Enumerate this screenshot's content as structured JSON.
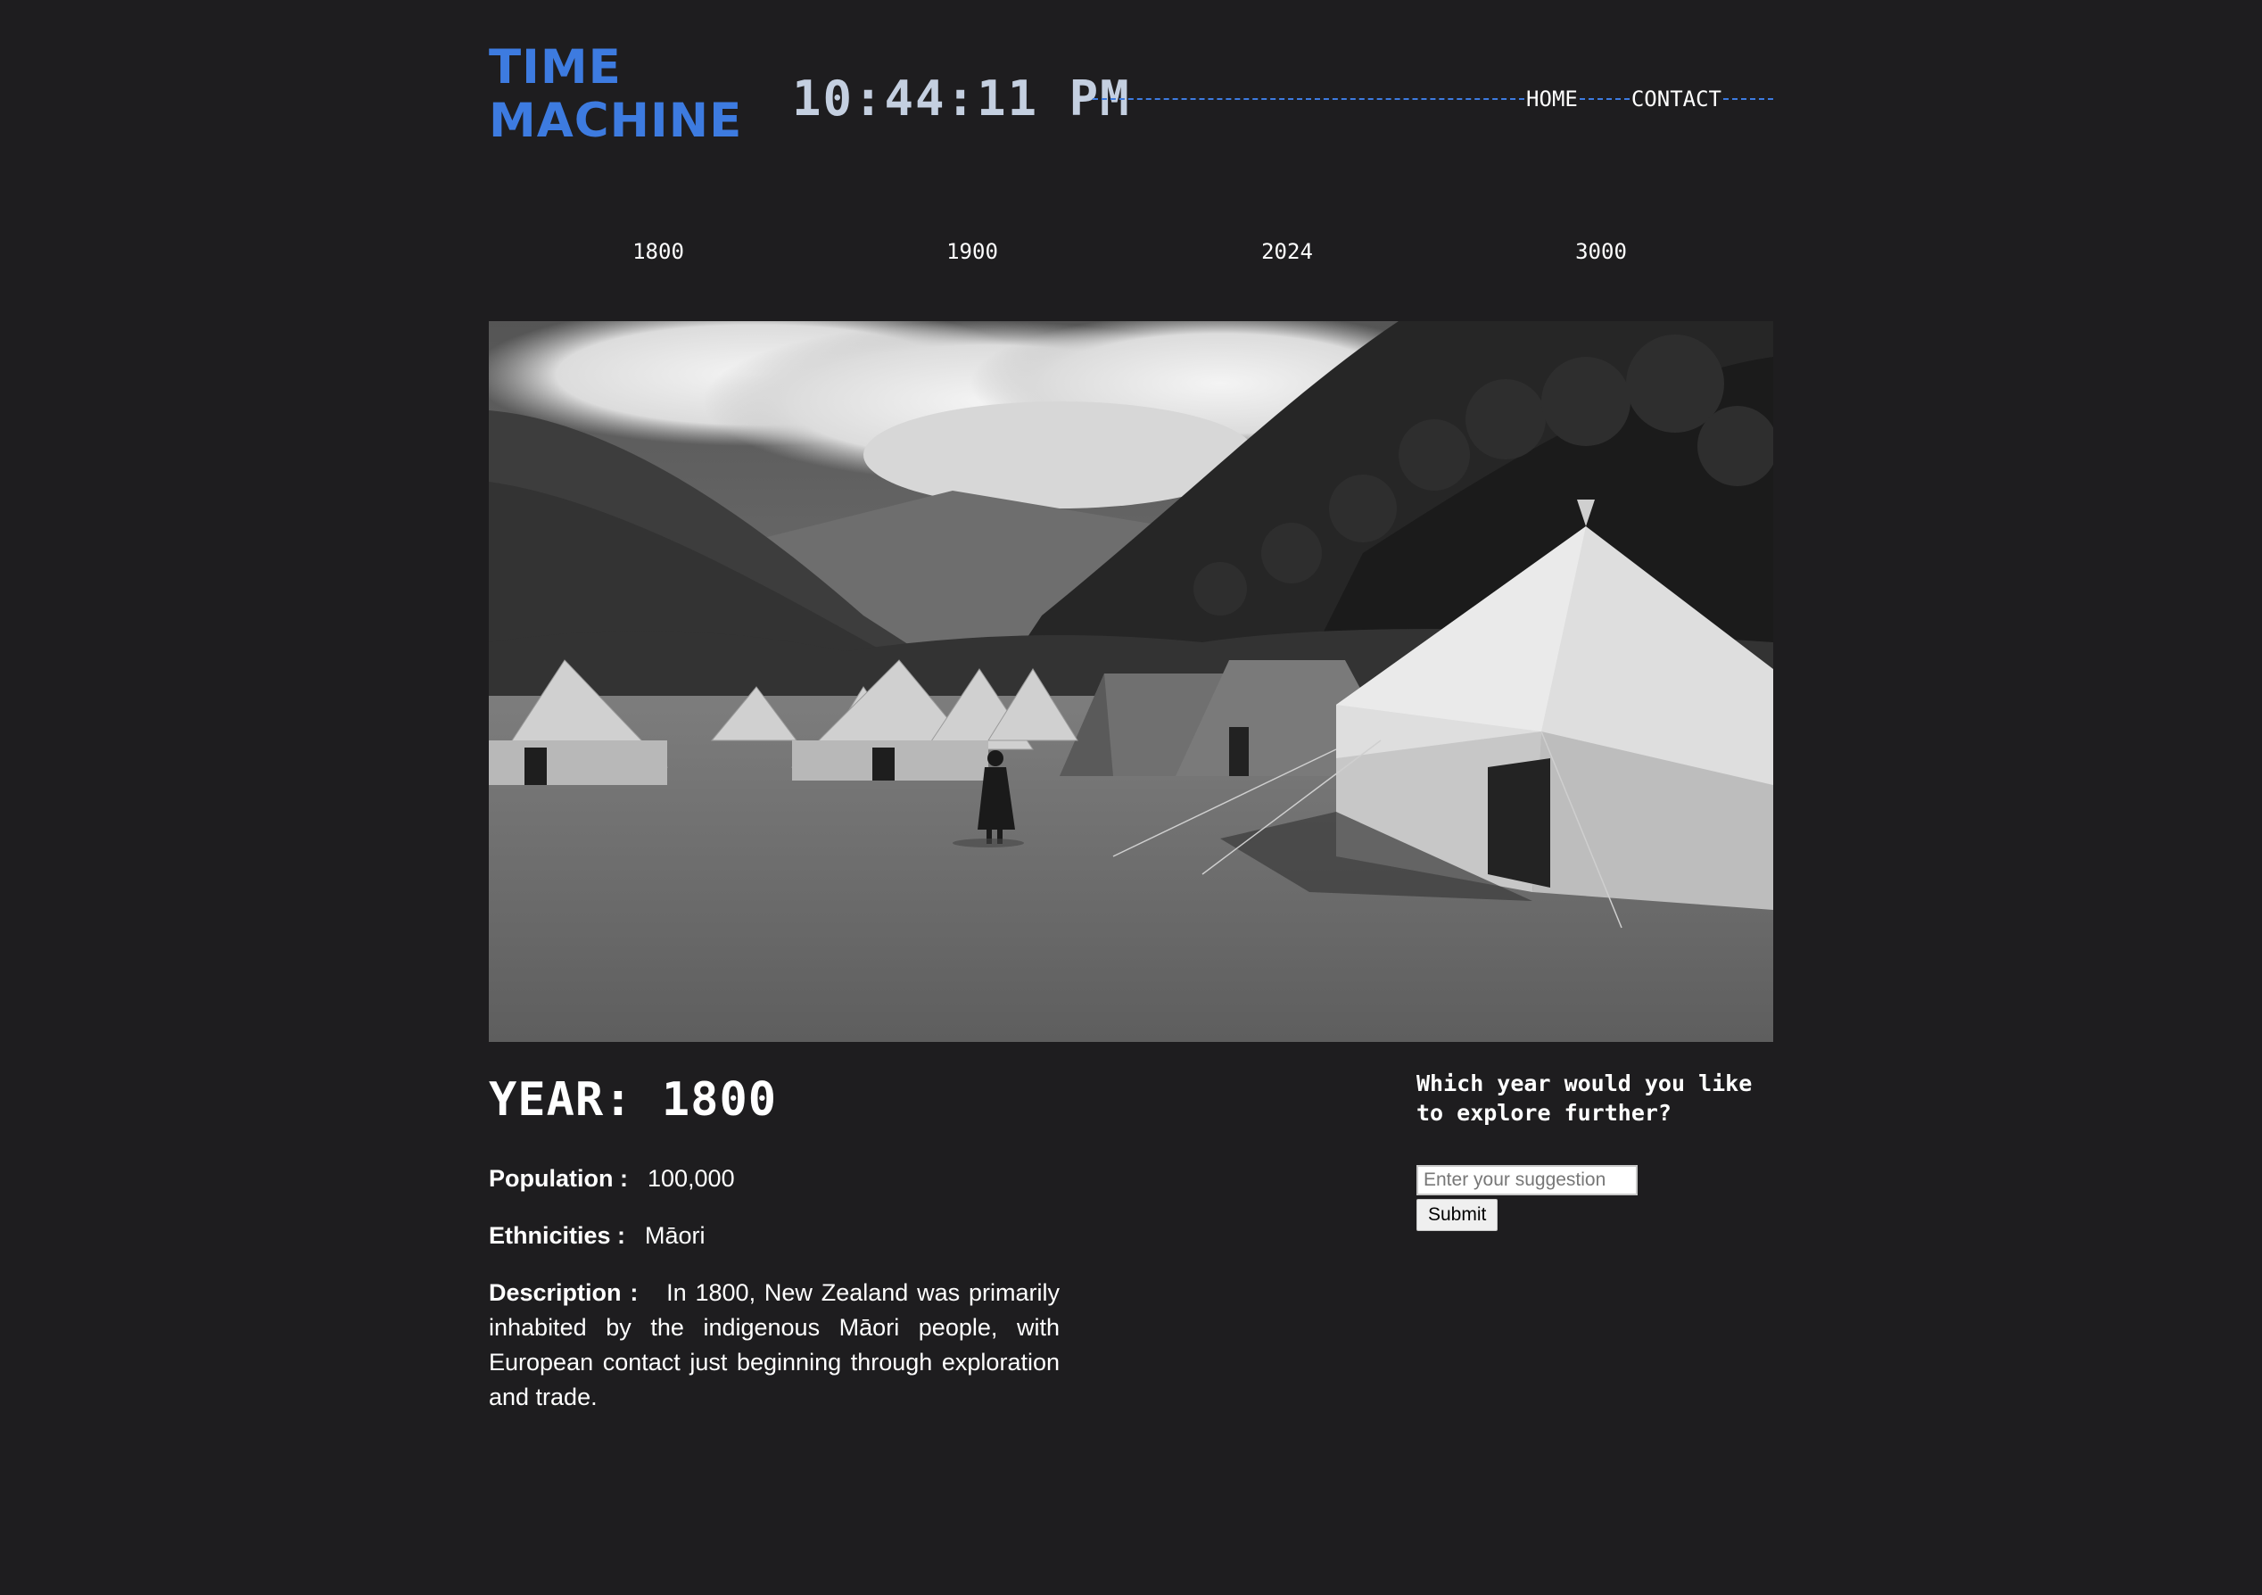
{
  "header": {
    "logo_line1": "TIME",
    "logo_line2": "MACHINE",
    "clock": "10:44:11 PM"
  },
  "nav": {
    "home": "HOME",
    "contact": "CONTACT"
  },
  "timeline": {
    "years": [
      "1800",
      "1900",
      "2024",
      "3000"
    ]
  },
  "hero": {
    "image_description": "black-and-white landscape"
  },
  "details": {
    "year_title": "YEAR: 1800",
    "population_label": "Population :",
    "population_value": "100,000",
    "ethnicities_label": "Ethnicities :",
    "ethnicities_value": "Māori",
    "description_label": "Description :",
    "description_value": "In 1800, New Zealand was primarily inhabited by the indigenous Māori people, with European contact just beginning through exploration and trade."
  },
  "suggestion": {
    "question": "Which year would you like to explore further?",
    "placeholder": "Enter your suggestion",
    "submit_label": "Submit"
  },
  "colors": {
    "background": "#1e1d1f",
    "accent": "#3d7be0",
    "clock": "#c4cfe0",
    "text": "#ffffff"
  }
}
